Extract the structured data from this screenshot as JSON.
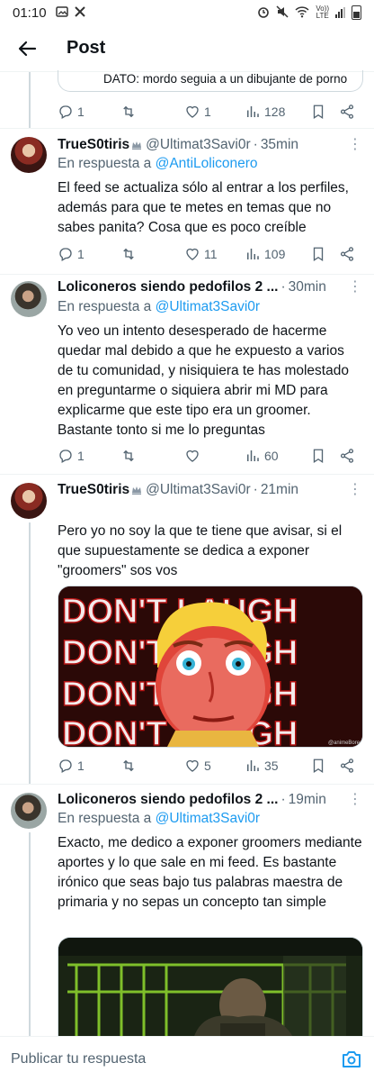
{
  "status_bar": {
    "time": "01:10",
    "left_icons": [
      "image-icon",
      "x-logo-icon"
    ],
    "right_icons": [
      "alarm-icon",
      "mute-icon",
      "wifi-icon",
      "volte-icon",
      "signal-icon",
      "battery-icon"
    ],
    "volte_label": "Vo))",
    "lte_label": "LTE"
  },
  "header": {
    "title": "Post"
  },
  "quoted_fragment": {
    "text": "DATO: mordo seguia a un dibujante de porno"
  },
  "first_actions": {
    "replies": "1",
    "retweets": "",
    "likes": "1",
    "views": "128"
  },
  "posts": [
    {
      "name": "TrueS0tiris",
      "handle": "@Ultimat3Savi0r",
      "time": "35min",
      "reply_prefix": "En respuesta a",
      "reply_to": "@AntiLoliconero",
      "text": "El feed se actualiza sólo al entrar a los perfiles, además para que te metes en temas que no sabes panita? Cosa que es poco creíble",
      "replies": "1",
      "retweets": "",
      "likes": "11",
      "views": "109"
    },
    {
      "name": "Loliconeros siendo pedofilos 2 ...",
      "handle": "",
      "time": "30min",
      "reply_prefix": "En respuesta a",
      "reply_to": "@Ultimat3Savi0r",
      "text": "Yo veo un intento desesperado de hacerme quedar mal debido a que he expuesto a varios de tu comunidad, y nisiquiera te has molestado en preguntarme o siquiera abrir mi MD para explicarme que este tipo era un groomer. Bastante tonto si me lo preguntas",
      "replies": "1",
      "retweets": "",
      "likes": "",
      "views": "60"
    },
    {
      "name": "TrueS0tiris",
      "handle": "@Ultimat3Savi0r",
      "time": "21min",
      "reply_prefix": "",
      "reply_to": "",
      "text": "Pero yo no soy la que te tiene que avisar, si el que supuestamente se dedica a exponer \"groomers\" sos vos",
      "media_text": "DON'T LAUGH",
      "media_watermark": "@animeBored",
      "replies": "1",
      "retweets": "",
      "likes": "5",
      "views": "35"
    },
    {
      "name": "Loliconeros siendo pedofilos 2 ...",
      "handle": "",
      "time": "19min",
      "reply_prefix": "En respuesta a",
      "reply_to": "@Ultimat3Savi0r",
      "text": "Exacto, me dedico a exponer groomers mediante aportes y lo que sale en mi feed. Es bastante irónico que seas bajo tus palabras maestra de primaria y no sepas un concepto tan simple"
    }
  ],
  "compose": {
    "placeholder": "Publicar tu respuesta"
  },
  "colors": {
    "accent": "#1d9bf0",
    "secondary_text": "#536471",
    "divider": "#eff3f4"
  }
}
